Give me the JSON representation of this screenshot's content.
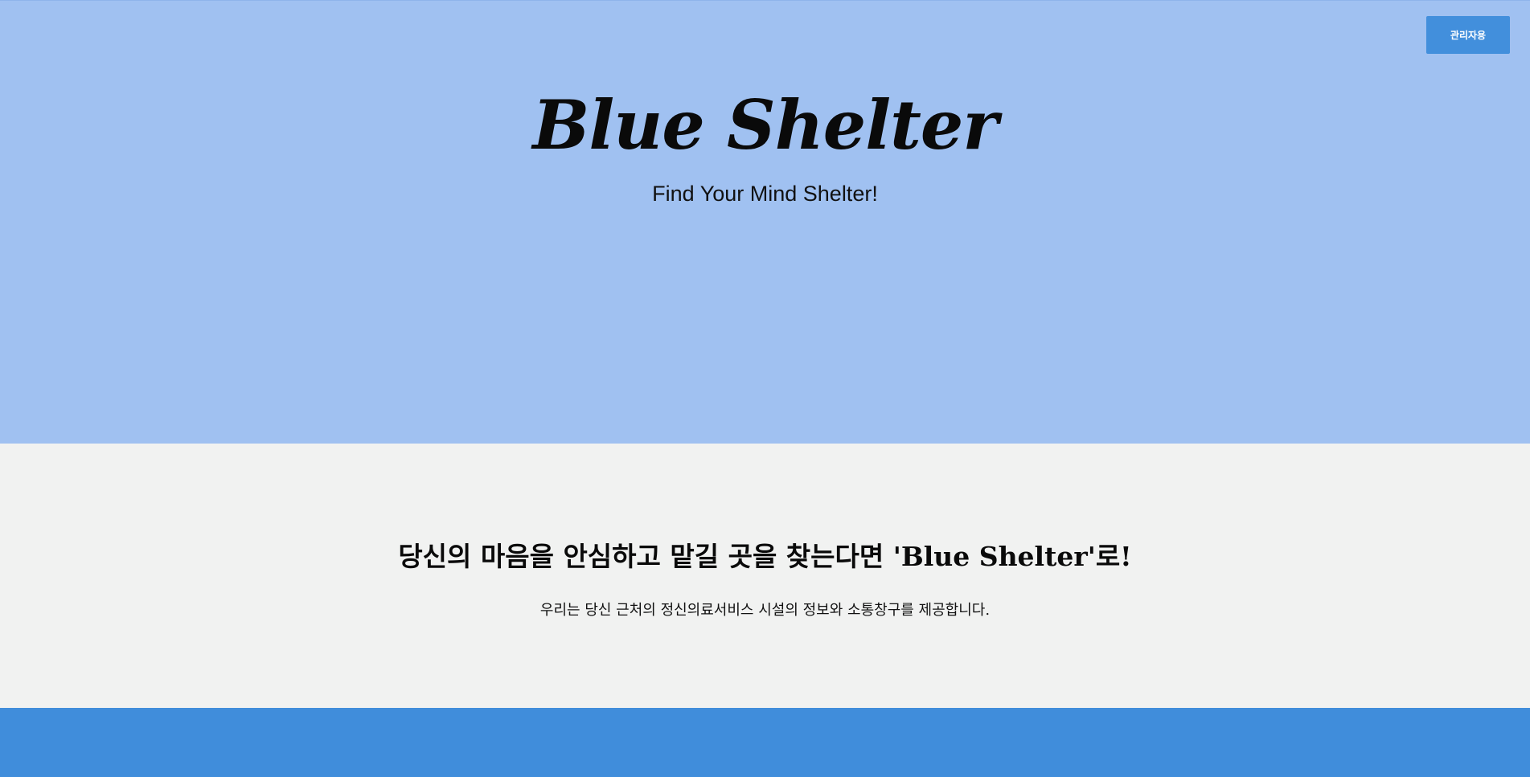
{
  "header": {
    "admin_button_label": "관리자용"
  },
  "hero": {
    "title": "Blue Shelter",
    "subtitle": "Find Your Mind Shelter!"
  },
  "intro": {
    "heading": "당신의 마음을 안심하고 맡길 곳을 찾는다면 'Blue Shelter'로!",
    "text": "우리는 당신 근처의 정신의료서비스 시설의 정보와 소통창구를 제공합니다."
  },
  "colors": {
    "hero_background": "#a0c1f1",
    "admin_button": "#428fdc",
    "intro_background": "#f1f2f1",
    "footer_band": "#408ddb"
  }
}
